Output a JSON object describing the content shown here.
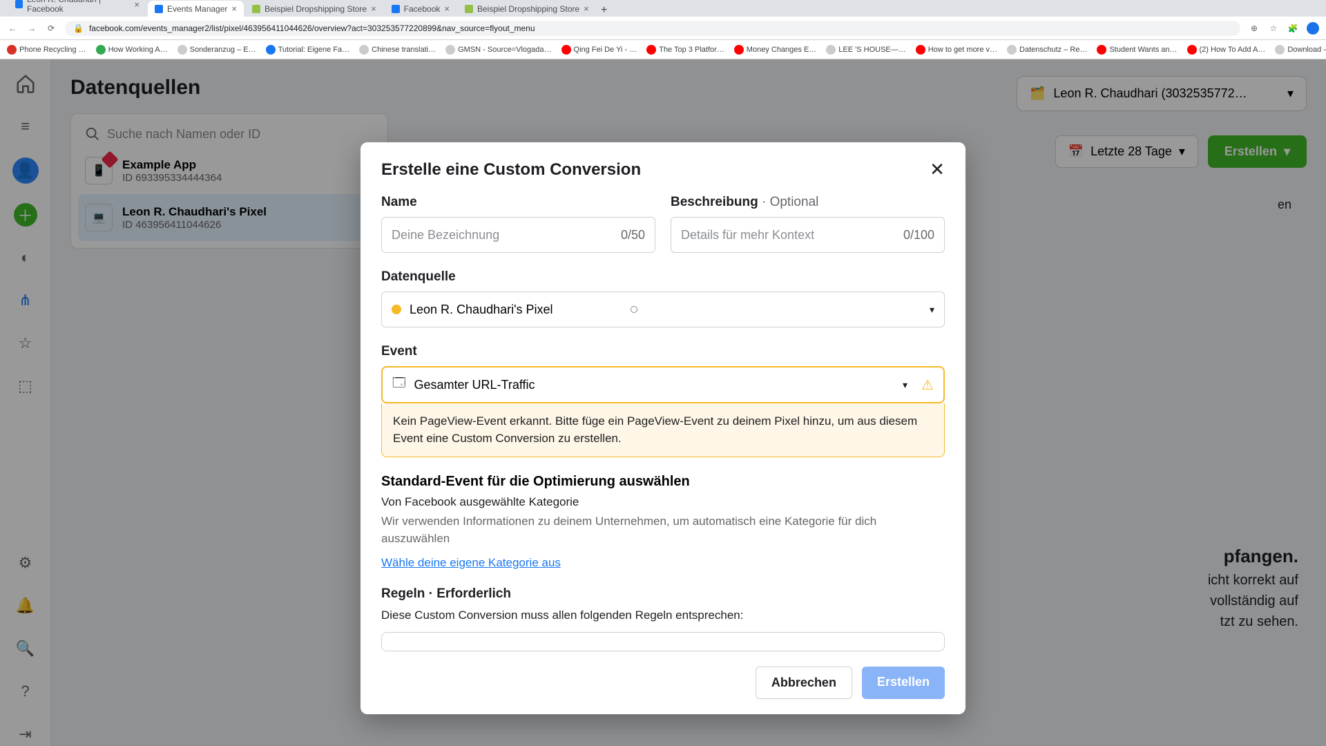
{
  "browser": {
    "tabs": [
      {
        "title": "Leon R. Chaudhari | Facebook"
      },
      {
        "title": "Events Manager"
      },
      {
        "title": "Beispiel Dropshipping Store"
      },
      {
        "title": "Facebook"
      },
      {
        "title": "Beispiel Dropshipping Store"
      }
    ],
    "url": "facebook.com/events_manager2/list/pixel/463956411044626/overview?act=303253577220899&nav_source=flyout_menu",
    "bookmarks": [
      "Phone Recycling …",
      "How Working A…",
      "Sonderanzug – E…",
      "Tutorial: Eigene Fa…",
      "Chinese translati…",
      "GMSN - Source=Vlogada…",
      "Qing Fei De Yi - …",
      "The Top 3 Platfor…",
      "Money Changes E…",
      "LEE 'S HOUSE—…",
      "How to get more v…",
      "Datenschutz – Re…",
      "Student Wants an…",
      "(2) How To Add A…",
      "Download – Cooki…"
    ]
  },
  "page": {
    "title": "Datenquellen",
    "search_placeholder": "Suche nach Namen oder ID",
    "account_label": "Leon R. Chaudhari (3032535772…",
    "date_label": "Letzte 28 Tage",
    "create_label": "Erstellen",
    "items": [
      {
        "title": "Example App",
        "sub": "ID 693395334444364"
      },
      {
        "title": "Leon R. Chaudhari's Pixel",
        "sub": "ID 463956411044626"
      }
    ],
    "bg_heading_tail": "pfangen.",
    "bg_line1_tail": "icht korrekt auf",
    "bg_line2_tail": "vollständig auf",
    "bg_line3_tail": "tzt zu sehen.",
    "bg_small": "en"
  },
  "modal": {
    "title": "Erstelle eine Custom Conversion",
    "name_label": "Name",
    "name_placeholder": "Deine Bezeichnung",
    "name_counter": "0/50",
    "desc_label": "Beschreibung",
    "desc_optional": " · Optional",
    "desc_placeholder": "Details für mehr Kontext",
    "desc_counter": "0/100",
    "source_label": "Datenquelle",
    "source_value": "Leon R. Chaudhari's Pixel",
    "event_label": "Event",
    "event_value": "Gesamter URL-Traffic",
    "event_warning": "Kein PageView-Event erkannt. Bitte füge ein PageView-Event zu deinem Pixel hinzu, um aus diesem Event eine Custom Conversion zu erstellen.",
    "std_heading": "Standard-Event für die Optimierung auswählen",
    "std_sub": "Von Facebook ausgewählte Kategorie",
    "std_desc": "Wir verwenden Informationen zu deinem Unternehmen, um automatisch eine Kategorie für dich auszuwählen",
    "std_link": "Wähle deine eigene Kategorie aus",
    "rules_label": "Regeln",
    "rules_req": " · Erforderlich",
    "rules_desc": "Diese Custom Conversion muss allen folgenden Regeln entsprechen:",
    "cancel": "Abbrechen",
    "submit": "Erstellen"
  }
}
